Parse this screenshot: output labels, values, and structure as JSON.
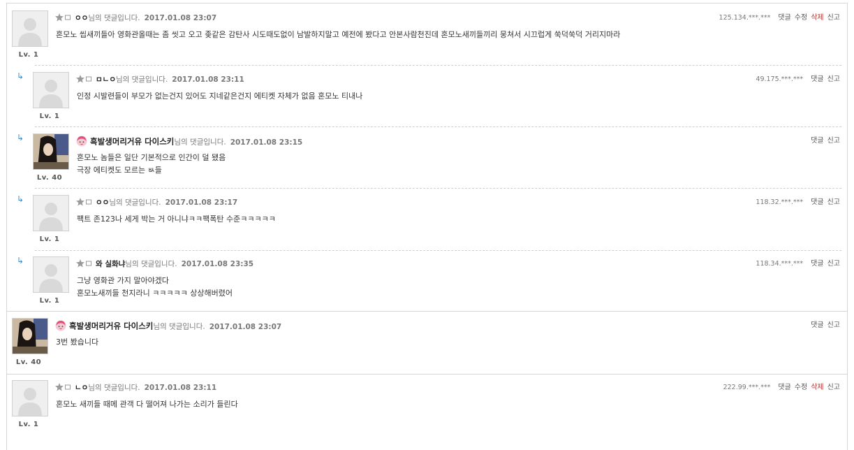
{
  "suffix": "님의 댓글입니다.",
  "labels": {
    "reply": "댓글",
    "edit": "수정",
    "delete": "삭제",
    "report": "신고"
  },
  "colors": {
    "reply_arrow": "#3a8fd0",
    "delete": "#b03030",
    "separator": "#d6d6d6"
  },
  "comments": [
    {
      "nick": "ㅇㅇ",
      "date": "2017.01.08 23:07",
      "ip": "125.134.***.***",
      "level": "Lv. 1",
      "avatar": "default",
      "badge": "anonymous-badge",
      "reply": false,
      "lines": [
        "혼모노 씹새끼들아 영화관올때는 좀 씻고 오고 좆같은 감탄사 시도때도없이 남발하지말고 예전에 봤다고 안본사람천진데 혼모노새끼들끼리 뭉쳐서 시끄럽게 쑥덕쑥덕 거리지마라"
      ],
      "actions": [
        "댓글",
        "수정",
        "삭제",
        "신고"
      ]
    },
    {
      "nick": "ㅁㄴㅇ",
      "date": "2017.01.08 23:11",
      "ip": "49.175.***.***",
      "level": "Lv. 1",
      "avatar": "default",
      "badge": "anonymous-badge",
      "reply": true,
      "lines": [
        "인정 시발련들이 부모가 없는건지 있어도 지네같은건지 에티켓 자체가 없음 혼모노 티내나"
      ],
      "actions": [
        "댓글",
        "신고"
      ]
    },
    {
      "nick": "흑발생머리거유 다이스키",
      "date": "2017.01.08 23:15",
      "ip": "",
      "level": "Lv. 40",
      "avatar": "photo",
      "badge": "member-badge",
      "reply": true,
      "lines": [
        "혼모노 놈들은 일단 기본적으로 인간이 덜 됐음",
        "극장 에티켓도 모르는 ㅄ들"
      ],
      "actions": [
        "댓글",
        "신고"
      ]
    },
    {
      "nick": "ㅇㅇ",
      "date": "2017.01.08 23:17",
      "ip": "118.32.***.***",
      "level": "Lv. 1",
      "avatar": "default",
      "badge": "anonymous-badge",
      "reply": true,
      "lines": [
        "팩트 존123나 세게 박는 거 아니냐ㅋㅋ팩폭탄 수준ㅋㅋㅋㅋㅋ"
      ],
      "actions": [
        "댓글",
        "신고"
      ]
    },
    {
      "nick": "와 실화냐",
      "date": "2017.01.08 23:35",
      "ip": "118.34.***.***",
      "level": "Lv. 1",
      "avatar": "default",
      "badge": "anonymous-badge",
      "reply": true,
      "lines": [
        "그냥 영화관 가지 말아야겠다",
        "혼모노새끼들 천지라니 ㅋㅋㅋㅋㅋ 상상해버렸어"
      ],
      "actions": [
        "댓글",
        "신고"
      ]
    },
    {
      "nick": "흑발생머리거유 다이스키",
      "date": "2017.01.08 23:07",
      "ip": "",
      "level": "Lv. 40",
      "avatar": "photo",
      "badge": "member-badge",
      "reply": false,
      "lines": [
        "3번 봤습니다"
      ],
      "actions": [
        "댓글",
        "신고"
      ]
    },
    {
      "nick": "ㄴㅇ",
      "date": "2017.01.08 23:11",
      "ip": "222.99.***.***",
      "level": "Lv. 1",
      "avatar": "default",
      "badge": "anonymous-badge",
      "reply": false,
      "lines": [
        "혼모노 새끼들 때메 관객 다 떨어져 나가는 소리가 들린다"
      ],
      "actions": [
        "댓글",
        "수정",
        "삭제",
        "신고"
      ]
    }
  ]
}
